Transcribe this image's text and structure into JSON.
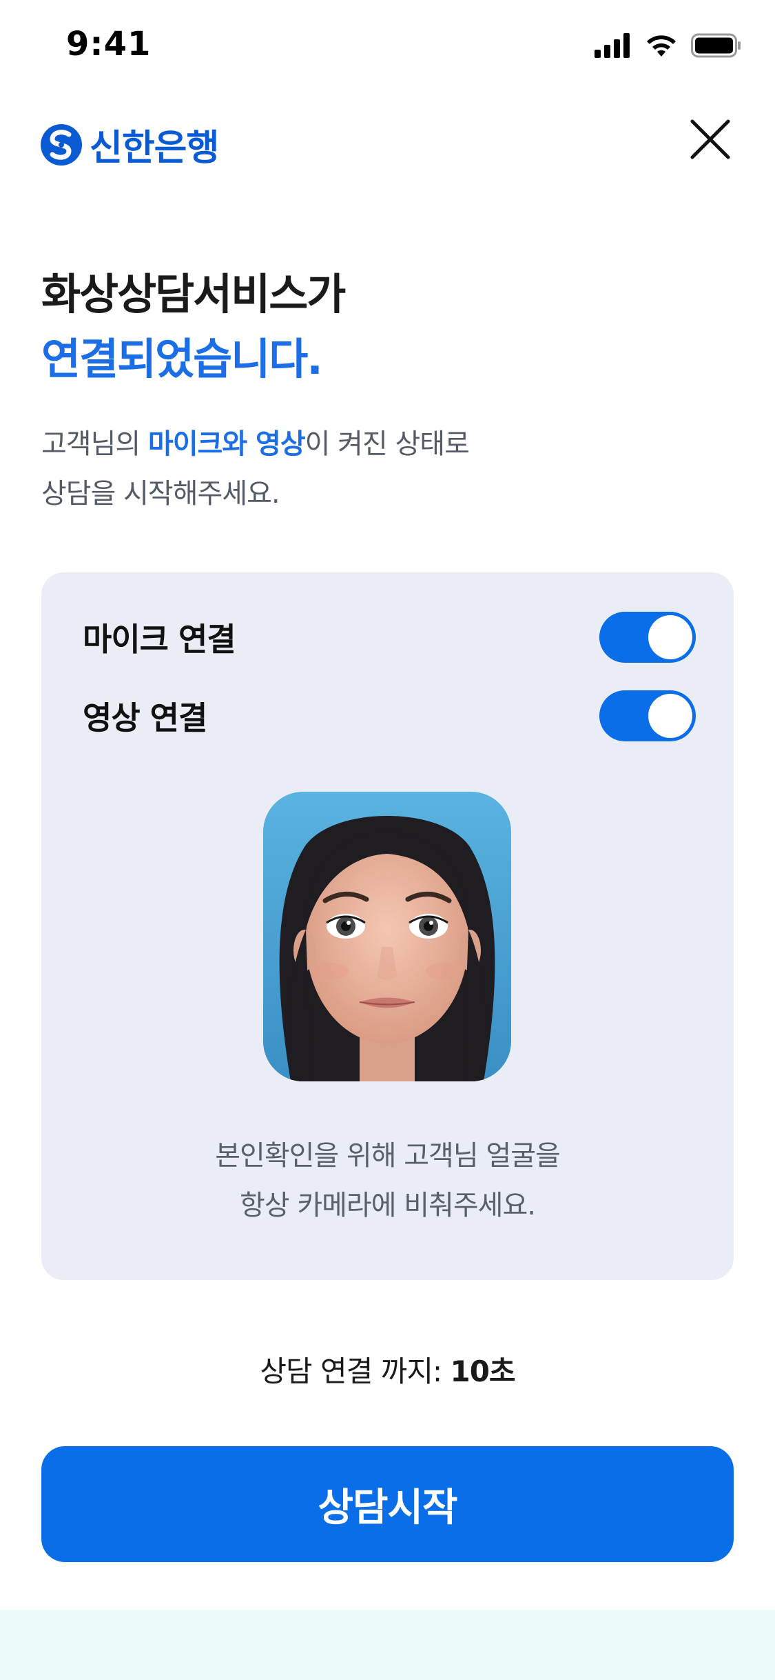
{
  "status_bar": {
    "time": "9:41",
    "icons": [
      "signal-icon",
      "wifi-icon",
      "battery-icon"
    ]
  },
  "header": {
    "logo_text": "신한은행",
    "logo_icon": "shinhan-logo-icon",
    "close_icon": "close-icon"
  },
  "title": {
    "line1": "화상상담서비스가",
    "line2": "연결되었습니다."
  },
  "description": {
    "part1": "고객님의 ",
    "highlight": "마이크와 영상",
    "part2": "이 켜진 상태로",
    "line2": "상담을 시작해주세요."
  },
  "card": {
    "mic_label": "마이크 연결",
    "mic_on": true,
    "video_label": "영상 연결",
    "video_on": true,
    "note_line1": "본인확인을 위해 고객님 얼굴을",
    "note_line2": "항상 카메라에 비춰주세요."
  },
  "countdown": {
    "label": "상담 연결 까지: ",
    "value": "10초"
  },
  "cta": {
    "label": "상담시작"
  },
  "colors": {
    "brand": "#0a5bd3",
    "accent": "#1b6ee5",
    "button": "#0a6ee8",
    "card_bg": "#eaedf5"
  }
}
